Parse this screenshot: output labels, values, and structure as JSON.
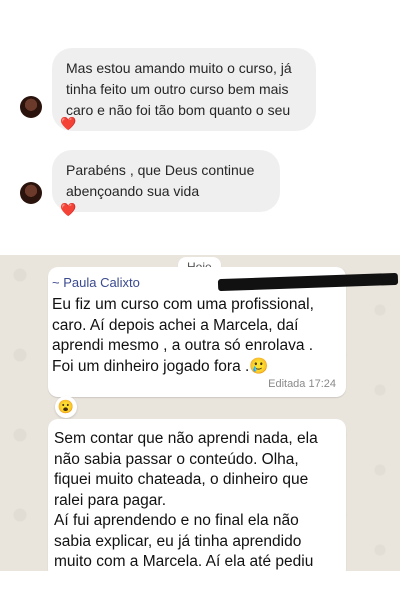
{
  "instagram": {
    "messages": [
      {
        "text": "Mas estou amando muito o curso, já tinha feito um outro curso bem mais caro e não foi tão bom quanto o seu",
        "reaction": "❤️"
      },
      {
        "text": "Parabéns , que Deus continue abençoando sua vida",
        "reaction": "❤️"
      }
    ]
  },
  "whatsapp": {
    "date_label": "Hoje",
    "messages": [
      {
        "sender": "~ Paula Calixto",
        "text": "Eu fiz um curso com uma profissional, caro. Aí depois achei a Marcela, daí aprendi mesmo , a outra só enrolava . Foi um dinheiro jogado fora .🥲",
        "meta": "Editada  17:24",
        "reaction": "😮"
      },
      {
        "text": "Sem contar que não aprendi nada, ela não sabia passar o conteúdo. Olha, fiquei muito chateada, o dinheiro que ralei para pagar.\nAí fui aprendendo e no final ela não sabia explicar, eu já tinha aprendido muito com a Marcela. Aí ela até pediu"
      }
    ]
  }
}
